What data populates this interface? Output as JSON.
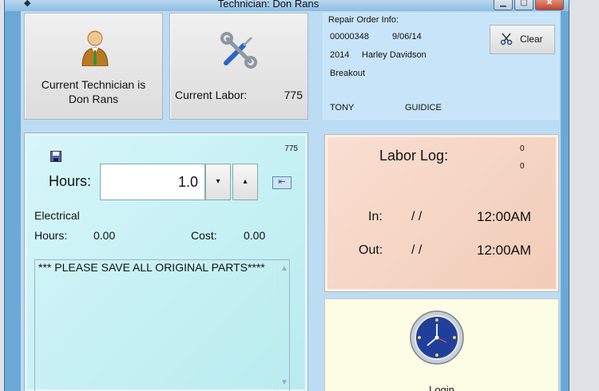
{
  "window": {
    "title": "Technician: Don Rans",
    "controls": {
      "minimize": "▁",
      "maximize": "▢",
      "close": "✕"
    }
  },
  "technician": {
    "label": "Current Technician is\nDon Rans"
  },
  "labor": {
    "label": "Current Labor:",
    "value": "775"
  },
  "repair_order": {
    "header": "Repair Order Info:",
    "number": "00000348",
    "date": "9/06/14",
    "year": "2014",
    "make": "Harley Davidson",
    "model": "Breakout",
    "first_name": "TONY",
    "last_name": "GUIDICE",
    "clear_label": "Clear"
  },
  "entry": {
    "labor_number": "775",
    "hours_label": "Hours:",
    "hours_value": "1.0",
    "decrement_label": "▾",
    "increment_label": "▴",
    "apply_label": "⇤",
    "category": "Electrical",
    "hours_text_label": "Hours:",
    "hours_text_value": "0.00",
    "cost_label": "Cost:",
    "cost_value": "0.00",
    "notes": "*** PLEASE SAVE ALL ORIGINAL PARTS****"
  },
  "labor_log": {
    "title": "Labor Log:",
    "count_1": "0",
    "count_2": "0",
    "in_label": "In:",
    "in_date": "/ /",
    "in_time": "12:00AM",
    "out_label": "Out:",
    "out_date": "/ /",
    "out_time": "12:00AM"
  },
  "login": {
    "label": "Login"
  },
  "colors": {
    "window_frame": "#6aa8d6",
    "client_bg": "#bcdcf4",
    "entry_bg": "#c6f1f3",
    "log_bg": "#f4d3c2",
    "login_bg": "#fdfde6"
  }
}
